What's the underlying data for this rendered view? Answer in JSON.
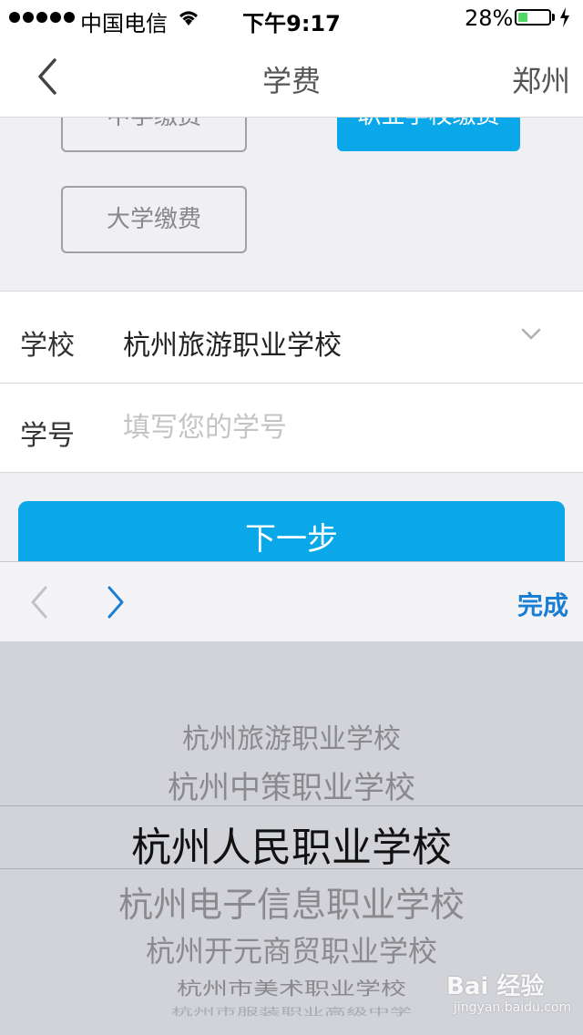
{
  "status_bar": {
    "carrier": "中国电信",
    "time": "下午9:17",
    "battery_pct": "28%",
    "battery_level": 0.28
  },
  "nav": {
    "back_icon": "chevron-left-icon",
    "title": "学费",
    "city": "郑州"
  },
  "payment_types": {
    "middle_school": "中学缴费",
    "vocational": "职业学校缴费",
    "university": "大学缴费"
  },
  "form": {
    "school_label": "学校",
    "school_value": "杭州旅游职业学校",
    "id_label": "学号",
    "id_placeholder": "填写您的学号",
    "id_value": ""
  },
  "next_button": "下一步",
  "toolbar": {
    "done": "完成"
  },
  "picker": {
    "options": [
      "杭州旅游职业学校",
      "杭州中策职业学校",
      "杭州人民职业学校",
      "杭州电子信息职业学校",
      "杭州开元商贸职业学校",
      "杭州市美术职业学校",
      "杭州市服装职业高级中学"
    ],
    "selected_index": 2
  },
  "watermark": {
    "brand": "Bai 经验",
    "url": "jingyan.baidu.com"
  },
  "colors": {
    "accent": "#0aa8e8",
    "done_blue": "#1a7fd4",
    "picker_bg": "#d1d3d9"
  }
}
